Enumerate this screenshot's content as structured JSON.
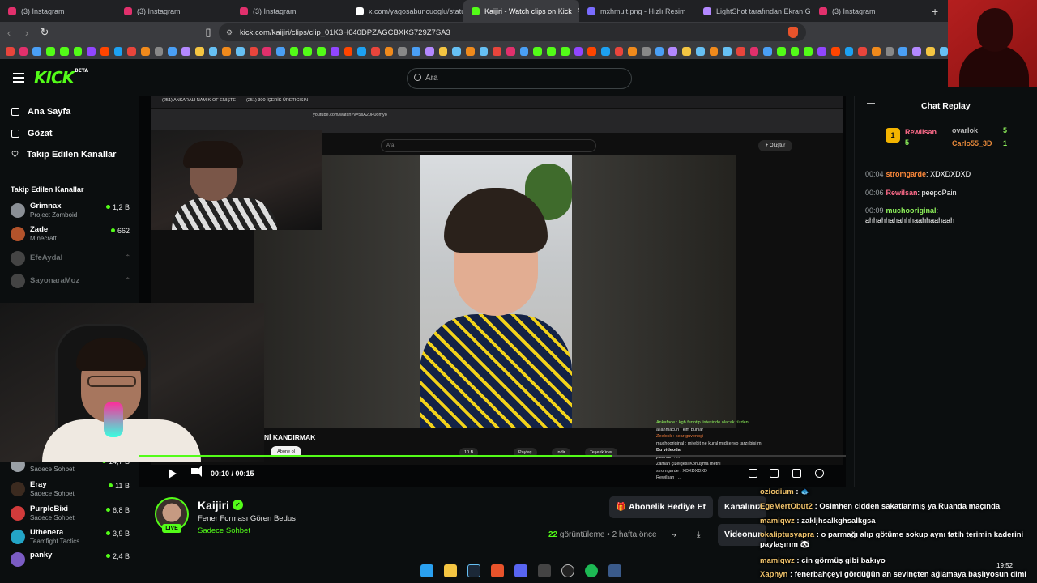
{
  "browser": {
    "tabs": [
      {
        "label": "(3) Instagram",
        "color": "#e1306c"
      },
      {
        "label": "(3) Instagram",
        "color": "#e1306c"
      },
      {
        "label": "(3) Instagram",
        "color": "#e1306c"
      },
      {
        "label": "x.com/yagosabuncuoglu/status",
        "color": "#ffffff"
      },
      {
        "label": "Kaijiri - Watch clips on Kick",
        "color": "#53fc18"
      },
      {
        "label": "mxhmuit.png - Hızlı Resim",
        "color": "#7a6cff"
      },
      {
        "label": "LightShot tarafından Ekran Gö",
        "color": "#b388ff"
      },
      {
        "label": "(3) Instagram",
        "color": "#e1306c"
      }
    ],
    "url": "kick.com/kaijiri/clips/clip_01K3H640DPZAGCBXKS729Z7SA3",
    "new_tab": "+"
  },
  "kick": {
    "logo": "KICK",
    "logo_sup": "BETA",
    "search_placeholder": "Ara",
    "nav": [
      {
        "label": "Ana Sayfa",
        "icon": "home-icon"
      },
      {
        "label": "Gözat",
        "icon": "browse-icon"
      },
      {
        "label": "Takip Edilen Kanallar",
        "icon": "heart-icon"
      }
    ],
    "following_header": "Takip Edilen Kanallar",
    "channels_top": [
      {
        "name": "Grimnax",
        "game": "Project Zomboid",
        "viewers": "1,2 B",
        "color": "#8a8f95"
      },
      {
        "name": "Zade",
        "game": "Minecraft",
        "viewers": "662",
        "color": "#b3532b"
      },
      {
        "name": "EfeAydal",
        "game": "",
        "viewers": "",
        "color": "#555"
      },
      {
        "name": "SayonaraMoz",
        "game": "",
        "viewers": "",
        "color": "#555"
      }
    ],
    "channels_bottom": [
      {
        "name": "RRaenee",
        "game": "Sadece Sohbet",
        "viewers": "14,7 B",
        "color": "#9aa0a6"
      },
      {
        "name": "Eray",
        "game": "Sadece Sohbet",
        "viewers": "11 B",
        "color": "#3b2a1f"
      },
      {
        "name": "PurpleBixi",
        "game": "Sadece Sohbet",
        "viewers": "6,8 B",
        "color": "#d13b3b"
      },
      {
        "name": "Uthenera",
        "game": "Teamfight Tactics",
        "viewers": "3,9 B",
        "color": "#23a5c7"
      },
      {
        "name": "panky",
        "game": "",
        "viewers": "2,4 B",
        "color": "#7b5cc4"
      }
    ]
  },
  "inner_browser": {
    "tab1": "(251) ANKARALI NAMIK-OF ENIŞTE",
    "tab2": "(251) 300 İÇERİK ÜRETICISIN",
    "url": "youtube.com/watch?v=5sA20F0omyo",
    "search": "Ara",
    "create": "+ Oluştur",
    "video_title": "Nİ KANDIRMAK",
    "subscribe": "Abone ol",
    "actions": [
      "10 B",
      "Paylaş",
      "İndir",
      "Teşekkürler"
    ],
    "chat": [
      "Ankafade : kgb fenotip listesinde olacak türden",
      "allahmacun : kim bunlar",
      "Zeelock : sear guvenbgi",
      "muchooriginal : mitebit ne kural mıditenyo tarzı bişi mi",
      "Bu videoda",
      "jiaxmain : ...",
      "Zaman çizelgesi   Konuşma metni",
      "stromgarde : XDXDXDXD",
      "Rewilsan : ..."
    ]
  },
  "player": {
    "time_current": "00:10",
    "time_total": "00:15",
    "progress": 0.67
  },
  "channel": {
    "name": "Kaijiri",
    "live": "LIVE",
    "clip_title": "Fener Forması Gören Bedus",
    "category": "Sadece Sohbet",
    "views_count": "22",
    "views_label": "görüntüleme",
    "age": "2 hafta önce",
    "gift_sub": "Abonelik Hediye Et",
    "kanal_btn": "Kanalınız",
    "video_btn": "Videonun"
  },
  "chat_replay": {
    "title": "Chat Replay",
    "leaderboard": [
      {
        "name": "Rewilsan",
        "count": "5",
        "color": "#ff6b8a"
      },
      {
        "name": "ovarlok",
        "count": "5",
        "color": "#bbbbbb"
      },
      {
        "name": "Carlo55_3D",
        "count": "1",
        "color": "#e8893a"
      }
    ],
    "messages": [
      {
        "time": "00:04",
        "user": "stromgarde",
        "color": "#ff8a3a",
        "text": "XDXDXDXD"
      },
      {
        "time": "00:06",
        "user": "Rewilsan",
        "color": "#ff6b8a",
        "text": "peepoPain"
      },
      {
        "time": "00:09",
        "user": "muchooriginal",
        "color": "#8df05a",
        "text": "ahhahhahahhhaahhaahaah"
      }
    ]
  },
  "overlay_chat": [
    {
      "user": "Xaphyn",
      "text": "fenerbahçeyi gördüğün an sevinçten ağlamaya başlıyosun dimi"
    },
    {
      "user": "mamiqwz",
      "text": "cin görmüş gibi bakıyo"
    },
    {
      "user": "okaliptusyapra",
      "text": "o parmağı alıp götüme sokup aynı fatih terimin kaderini paylaşırım 🐼"
    },
    {
      "user": "mamiqwz",
      "text": "zakljhsalkghsalkgsa"
    },
    {
      "user": "EgeMertObut2",
      "text": "Osimhen cidden sakatlanmış ya Ruanda maçında"
    },
    {
      "user": "oziodium",
      "text": "🐟"
    }
  ],
  "clock": "19:52"
}
